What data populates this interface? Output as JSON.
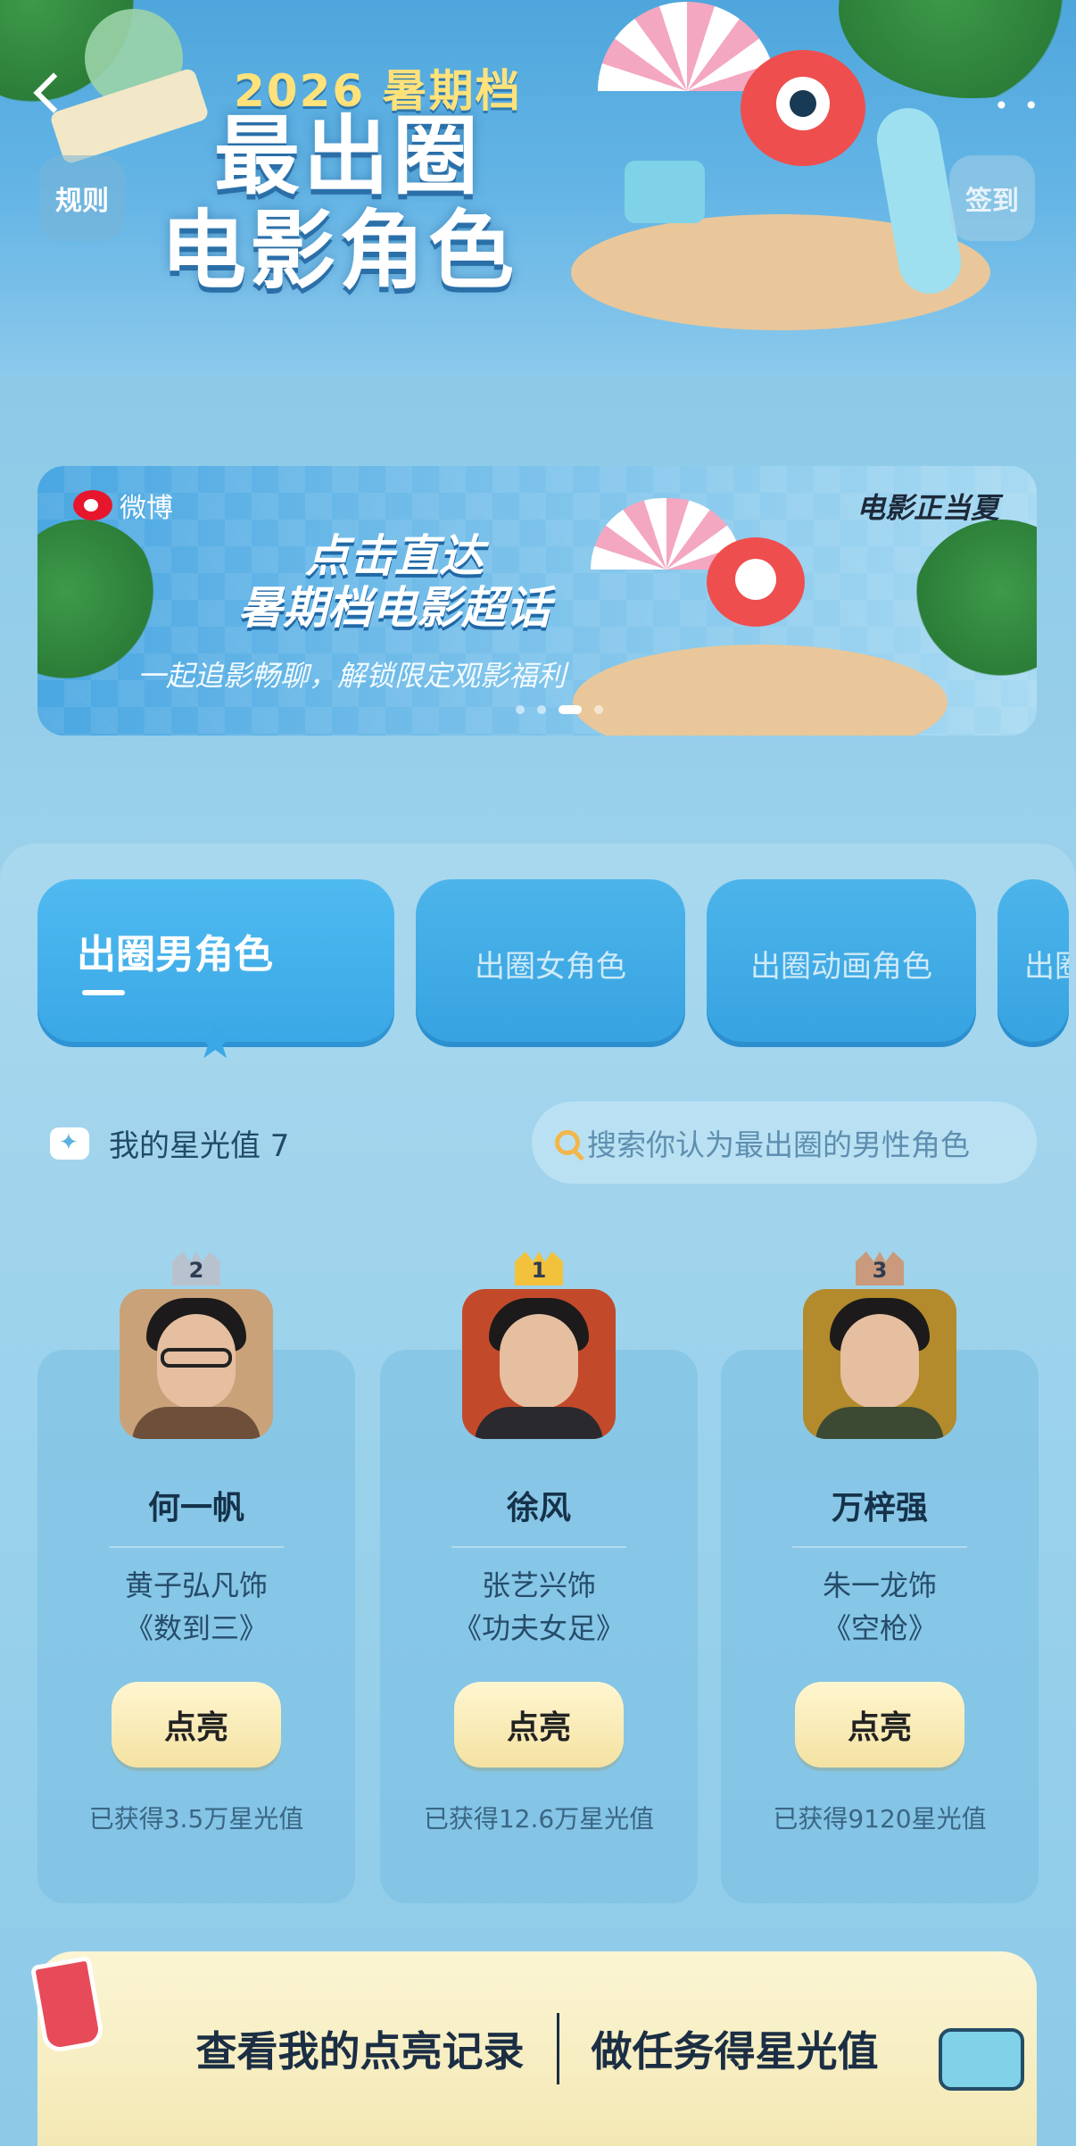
{
  "header": {
    "year_label": "2026 暑期档",
    "title_line1": "最出圈",
    "title_line2": "电影角色",
    "rules_label": "规则",
    "checkin_label": "签到",
    "more_label": "• •"
  },
  "banner": {
    "logo_text": "微博",
    "tag": "电影正当夏",
    "headline_line1": "点击直达",
    "headline_line2": "暑期档电影超话",
    "subline": "一起追影畅聊，解锁限定观影福利"
  },
  "tabs": [
    {
      "label": "出圈男角色",
      "active": true
    },
    {
      "label": "出圈女角色",
      "active": false
    },
    {
      "label": "出圈动画角色",
      "active": false
    },
    {
      "label": "出圈",
      "active": false
    }
  ],
  "starlight": {
    "label": "我的星光值 7"
  },
  "search": {
    "placeholder": "搜索你认为最出圈的男性角色"
  },
  "candidates": [
    {
      "rank": "2",
      "rank_color": "#b8c2cf",
      "name": "何一帆",
      "actor": "黄子弘凡饰",
      "movie": "《数到三》",
      "button": "点亮",
      "score": "已获得3.5万星光值",
      "bg": "#c9a27a",
      "shirt": "#6d4f3a"
    },
    {
      "rank": "1",
      "rank_color": "#f3c23c",
      "name": "徐风",
      "actor": "张艺兴饰",
      "movie": "《功夫女足》",
      "button": "点亮",
      "score": "已获得12.6万星光值",
      "bg": "#c24a2a",
      "shirt": "#2a2a2e"
    },
    {
      "rank": "3",
      "rank_color": "#c99a7c",
      "name": "万梓强",
      "actor": "朱一龙饰",
      "movie": "《空枪》",
      "button": "点亮",
      "score": "已获得9120星光值",
      "bg": "#b38a2c",
      "shirt": "#3c4a34"
    }
  ],
  "bottom": {
    "records_label": "查看我的点亮记录",
    "tasks_label": "做任务得星光值"
  }
}
